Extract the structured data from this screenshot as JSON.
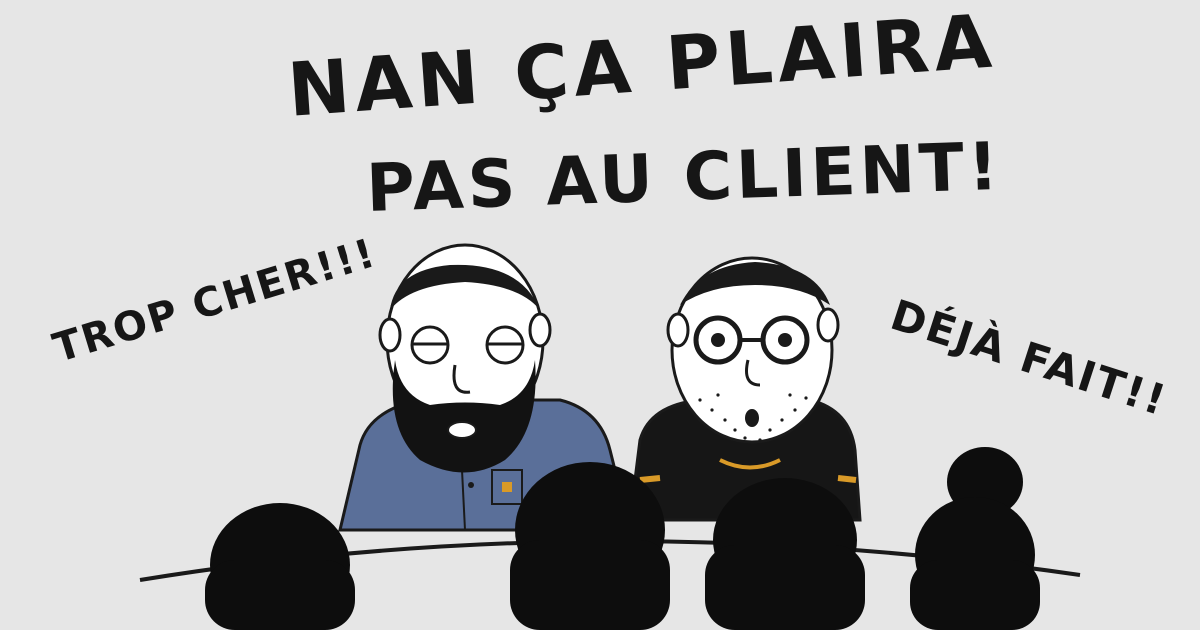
{
  "headline": {
    "line1": "NAN ÇA PLAIRA",
    "line2": "PAS AU CLIENT!"
  },
  "left_character": {
    "speech": "TROP CHER!!!"
  },
  "right_character": {
    "speech": "DÉJÀ FAIT!!"
  },
  "colors": {
    "background": "#e6e6e6",
    "ink": "#161616",
    "skin": "#ffffff",
    "shirt_left": "#5a6f99",
    "shirt_right": "#161616",
    "accent_gold": "#d99a28",
    "audience": "#0d0d0d"
  }
}
